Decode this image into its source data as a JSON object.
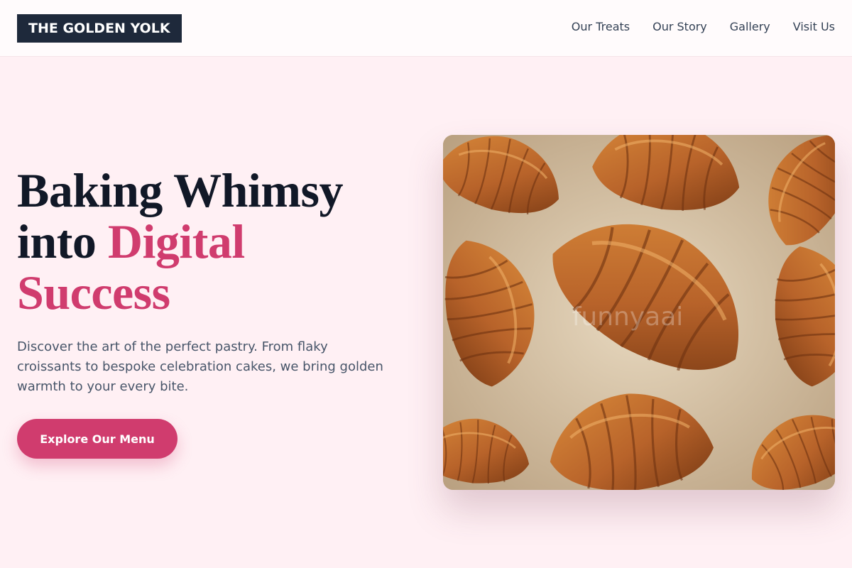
{
  "header": {
    "logo": "THE GOLDEN YOLK",
    "nav": [
      "Our Treats",
      "Our Story",
      "Gallery",
      "Visit Us"
    ]
  },
  "hero": {
    "title_line1": "Baking Whimsy",
    "title_line2_plain": "into ",
    "title_line2_accent": "Digital",
    "title_line3_accent": "Success",
    "description": "Discover the art of the perfect pastry. From flaky croissants to bespoke celebration cakes, we bring golden warmth to your every bite.",
    "cta_label": "Explore Our Menu",
    "image_watermark": "funnyaai"
  },
  "colors": {
    "background": "#fff0f4",
    "logo_bg": "#1e293b",
    "accent": "#d03c6e",
    "heading": "#111827",
    "body_text": "#475569"
  }
}
